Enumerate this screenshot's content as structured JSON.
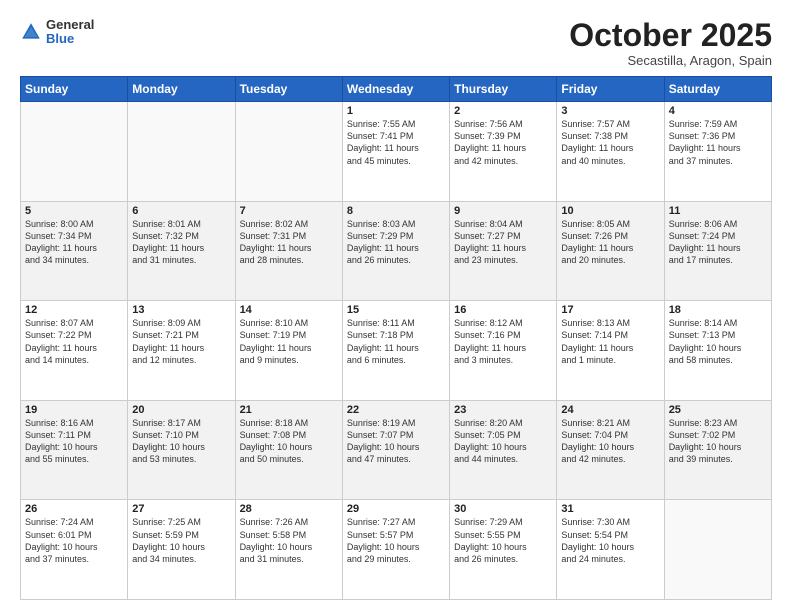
{
  "header": {
    "logo_general": "General",
    "logo_blue": "Blue",
    "month": "October 2025",
    "location": "Secastilla, Aragon, Spain"
  },
  "weekdays": [
    "Sunday",
    "Monday",
    "Tuesday",
    "Wednesday",
    "Thursday",
    "Friday",
    "Saturday"
  ],
  "weeks": [
    [
      {
        "day": "",
        "info": ""
      },
      {
        "day": "",
        "info": ""
      },
      {
        "day": "",
        "info": ""
      },
      {
        "day": "1",
        "info": "Sunrise: 7:55 AM\nSunset: 7:41 PM\nDaylight: 11 hours\nand 45 minutes."
      },
      {
        "day": "2",
        "info": "Sunrise: 7:56 AM\nSunset: 7:39 PM\nDaylight: 11 hours\nand 42 minutes."
      },
      {
        "day": "3",
        "info": "Sunrise: 7:57 AM\nSunset: 7:38 PM\nDaylight: 11 hours\nand 40 minutes."
      },
      {
        "day": "4",
        "info": "Sunrise: 7:59 AM\nSunset: 7:36 PM\nDaylight: 11 hours\nand 37 minutes."
      }
    ],
    [
      {
        "day": "5",
        "info": "Sunrise: 8:00 AM\nSunset: 7:34 PM\nDaylight: 11 hours\nand 34 minutes."
      },
      {
        "day": "6",
        "info": "Sunrise: 8:01 AM\nSunset: 7:32 PM\nDaylight: 11 hours\nand 31 minutes."
      },
      {
        "day": "7",
        "info": "Sunrise: 8:02 AM\nSunset: 7:31 PM\nDaylight: 11 hours\nand 28 minutes."
      },
      {
        "day": "8",
        "info": "Sunrise: 8:03 AM\nSunset: 7:29 PM\nDaylight: 11 hours\nand 26 minutes."
      },
      {
        "day": "9",
        "info": "Sunrise: 8:04 AM\nSunset: 7:27 PM\nDaylight: 11 hours\nand 23 minutes."
      },
      {
        "day": "10",
        "info": "Sunrise: 8:05 AM\nSunset: 7:26 PM\nDaylight: 11 hours\nand 20 minutes."
      },
      {
        "day": "11",
        "info": "Sunrise: 8:06 AM\nSunset: 7:24 PM\nDaylight: 11 hours\nand 17 minutes."
      }
    ],
    [
      {
        "day": "12",
        "info": "Sunrise: 8:07 AM\nSunset: 7:22 PM\nDaylight: 11 hours\nand 14 minutes."
      },
      {
        "day": "13",
        "info": "Sunrise: 8:09 AM\nSunset: 7:21 PM\nDaylight: 11 hours\nand 12 minutes."
      },
      {
        "day": "14",
        "info": "Sunrise: 8:10 AM\nSunset: 7:19 PM\nDaylight: 11 hours\nand 9 minutes."
      },
      {
        "day": "15",
        "info": "Sunrise: 8:11 AM\nSunset: 7:18 PM\nDaylight: 11 hours\nand 6 minutes."
      },
      {
        "day": "16",
        "info": "Sunrise: 8:12 AM\nSunset: 7:16 PM\nDaylight: 11 hours\nand 3 minutes."
      },
      {
        "day": "17",
        "info": "Sunrise: 8:13 AM\nSunset: 7:14 PM\nDaylight: 11 hours\nand 1 minute."
      },
      {
        "day": "18",
        "info": "Sunrise: 8:14 AM\nSunset: 7:13 PM\nDaylight: 10 hours\nand 58 minutes."
      }
    ],
    [
      {
        "day": "19",
        "info": "Sunrise: 8:16 AM\nSunset: 7:11 PM\nDaylight: 10 hours\nand 55 minutes."
      },
      {
        "day": "20",
        "info": "Sunrise: 8:17 AM\nSunset: 7:10 PM\nDaylight: 10 hours\nand 53 minutes."
      },
      {
        "day": "21",
        "info": "Sunrise: 8:18 AM\nSunset: 7:08 PM\nDaylight: 10 hours\nand 50 minutes."
      },
      {
        "day": "22",
        "info": "Sunrise: 8:19 AM\nSunset: 7:07 PM\nDaylight: 10 hours\nand 47 minutes."
      },
      {
        "day": "23",
        "info": "Sunrise: 8:20 AM\nSunset: 7:05 PM\nDaylight: 10 hours\nand 44 minutes."
      },
      {
        "day": "24",
        "info": "Sunrise: 8:21 AM\nSunset: 7:04 PM\nDaylight: 10 hours\nand 42 minutes."
      },
      {
        "day": "25",
        "info": "Sunrise: 8:23 AM\nSunset: 7:02 PM\nDaylight: 10 hours\nand 39 minutes."
      }
    ],
    [
      {
        "day": "26",
        "info": "Sunrise: 7:24 AM\nSunset: 6:01 PM\nDaylight: 10 hours\nand 37 minutes."
      },
      {
        "day": "27",
        "info": "Sunrise: 7:25 AM\nSunset: 5:59 PM\nDaylight: 10 hours\nand 34 minutes."
      },
      {
        "day": "28",
        "info": "Sunrise: 7:26 AM\nSunset: 5:58 PM\nDaylight: 10 hours\nand 31 minutes."
      },
      {
        "day": "29",
        "info": "Sunrise: 7:27 AM\nSunset: 5:57 PM\nDaylight: 10 hours\nand 29 minutes."
      },
      {
        "day": "30",
        "info": "Sunrise: 7:29 AM\nSunset: 5:55 PM\nDaylight: 10 hours\nand 26 minutes."
      },
      {
        "day": "31",
        "info": "Sunrise: 7:30 AM\nSunset: 5:54 PM\nDaylight: 10 hours\nand 24 minutes."
      },
      {
        "day": "",
        "info": ""
      }
    ]
  ]
}
